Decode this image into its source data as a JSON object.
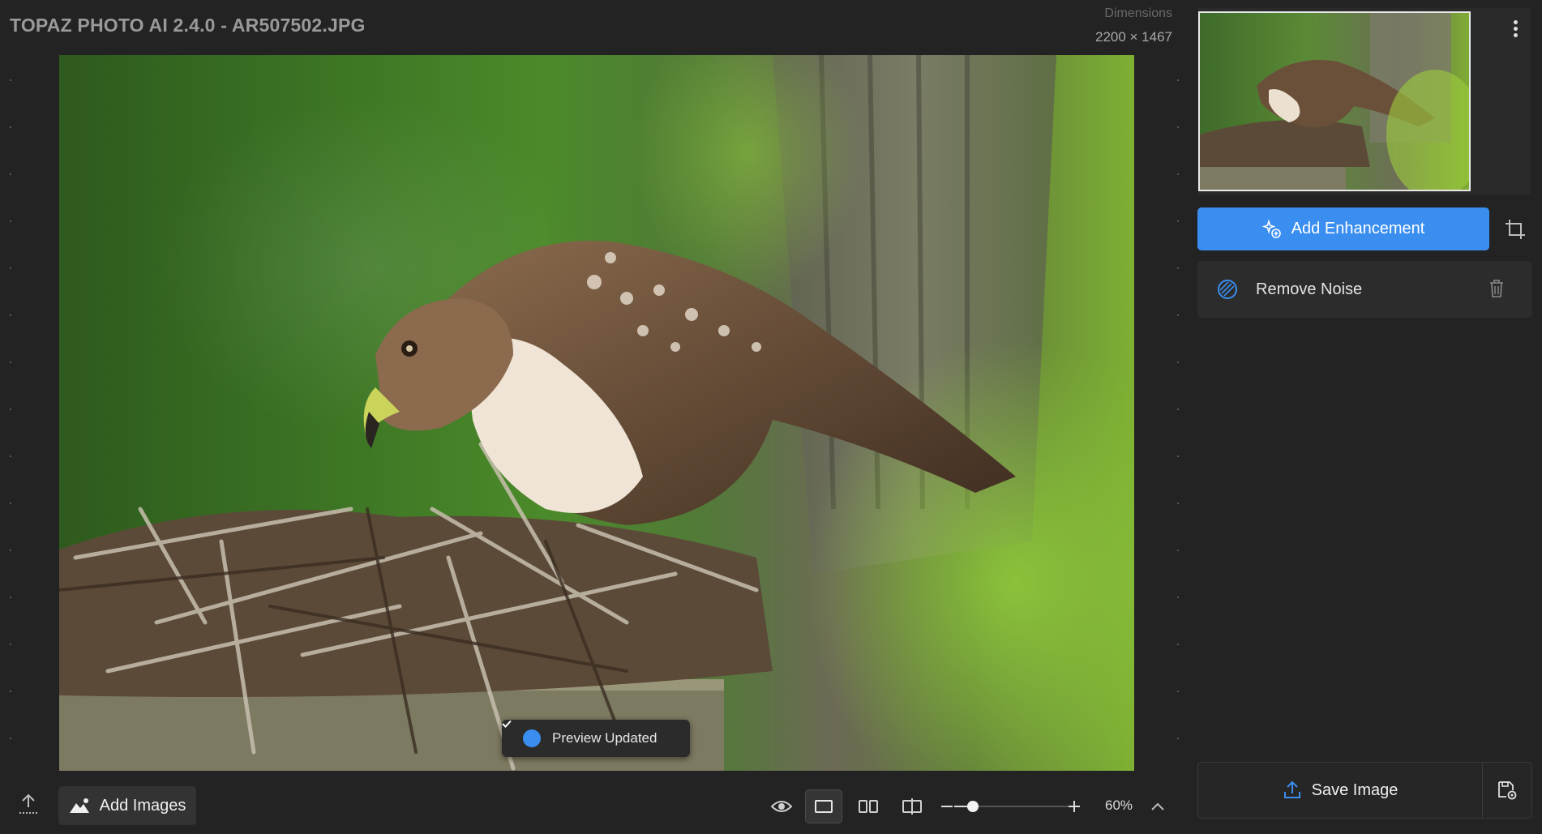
{
  "header": {
    "title": "TOPAZ PHOTO AI 2.4.0 - AR507502.JPG",
    "dimensions_label": "Dimensions",
    "dimensions_value": "2200 × 1467"
  },
  "canvas": {
    "toast": "Preview Updated"
  },
  "panel": {
    "add_enhancement": "Add Enhancement",
    "enhancements": [
      {
        "label": "Remove Noise"
      }
    ],
    "save_image": "Save Image"
  },
  "toolbar": {
    "add_images": "Add Images",
    "zoom_value": "60%",
    "zoom_level": 0.15
  },
  "colors": {
    "accent": "#3a8ef0",
    "background": "#232323",
    "panel": "#2c2c2c"
  }
}
